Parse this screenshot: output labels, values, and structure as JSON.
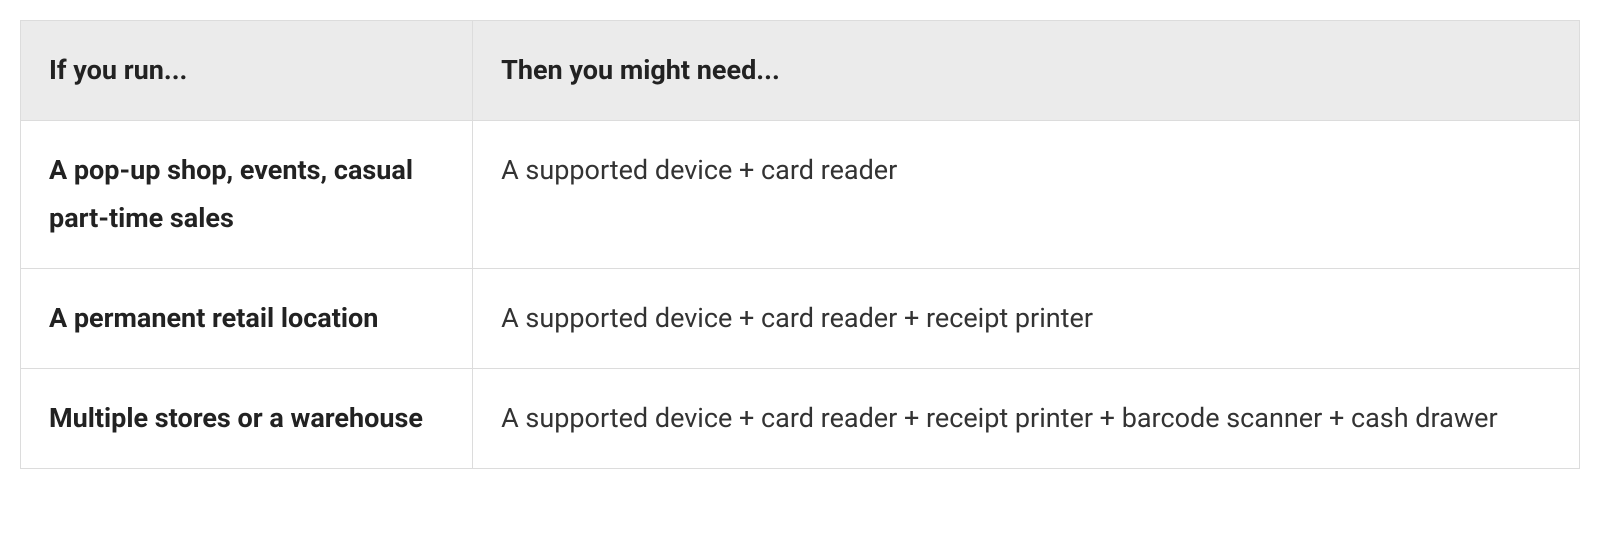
{
  "table": {
    "headers": {
      "col1": "If you run...",
      "col2": "Then you might need..."
    },
    "rows": [
      {
        "label": "A pop-up shop, events, casual part-time sales",
        "value": "A supported device + card reader"
      },
      {
        "label": "A permanent retail location",
        "value": "A supported device + card reader + receipt printer"
      },
      {
        "label": "Multiple stores or a warehouse",
        "value": "A supported device + card reader + receipt printer + barcode scanner + cash drawer"
      }
    ]
  },
  "chart_data": {
    "type": "table",
    "title": "",
    "columns": [
      "If you run...",
      "Then you might need..."
    ],
    "rows": [
      [
        "A pop-up shop, events, casual part-time sales",
        "A supported device + card reader"
      ],
      [
        "A permanent retail location",
        "A supported device + card reader + receipt printer"
      ],
      [
        "Multiple stores or a warehouse",
        "A supported device + card reader + receipt printer + barcode scanner + cash drawer"
      ]
    ]
  }
}
